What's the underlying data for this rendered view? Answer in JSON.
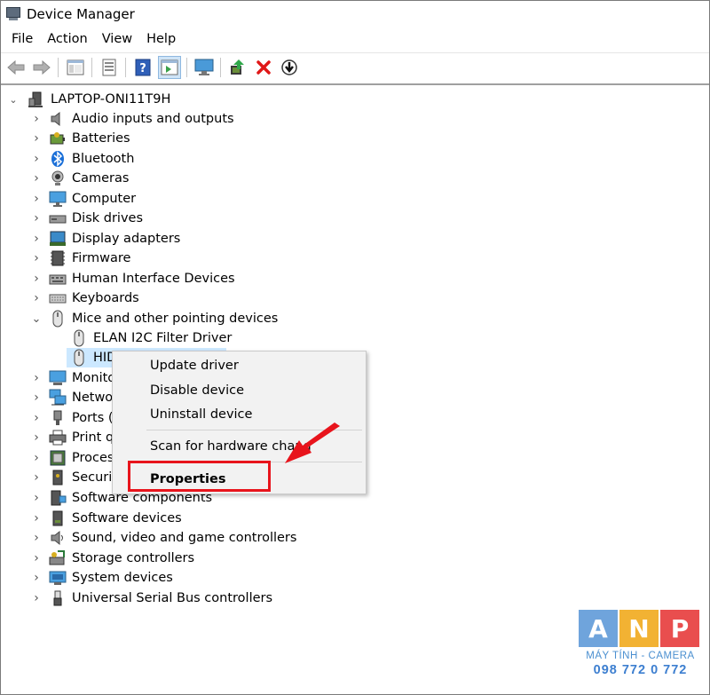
{
  "window": {
    "title": "Device Manager"
  },
  "menu": [
    "File",
    "Action",
    "View",
    "Help"
  ],
  "toolbar": [
    "back-icon",
    "forward-icon",
    "show-hide-console-tree-icon",
    "properties-icon",
    "help-icon",
    "action-pane-icon",
    "monitor-icon",
    "update-driver-icon",
    "uninstall-icon",
    "disable-icon"
  ],
  "tree": {
    "root": "LAPTOP-ONI11T9H",
    "categories": [
      {
        "label": "Audio inputs and outputs",
        "icon": "speaker-icon"
      },
      {
        "label": "Batteries",
        "icon": "battery-icon"
      },
      {
        "label": "Bluetooth",
        "icon": "bluetooth-icon"
      },
      {
        "label": "Cameras",
        "icon": "camera-icon"
      },
      {
        "label": "Computer",
        "icon": "computer-icon"
      },
      {
        "label": "Disk drives",
        "icon": "disk-icon"
      },
      {
        "label": "Display adapters",
        "icon": "display-adapter-icon"
      },
      {
        "label": "Firmware",
        "icon": "firmware-icon"
      },
      {
        "label": "Human Interface Devices",
        "icon": "hid-icon"
      },
      {
        "label": "Keyboards",
        "icon": "keyboard-icon"
      },
      {
        "label": "Mice and other pointing devices",
        "icon": "mouse-icon",
        "expanded": true
      },
      {
        "label": "Monito",
        "icon": "monitor-icon"
      },
      {
        "label": "Netwo",
        "icon": "network-icon"
      },
      {
        "label": "Ports (C",
        "icon": "port-icon"
      },
      {
        "label": "Print q",
        "icon": "printer-icon"
      },
      {
        "label": "Process",
        "icon": "processor-icon"
      },
      {
        "label": "Securit",
        "icon": "security-icon"
      },
      {
        "label": "Software components",
        "icon": "software-component-icon"
      },
      {
        "label": "Software devices",
        "icon": "software-device-icon"
      },
      {
        "label": "Sound, video and game controllers",
        "icon": "sound-icon"
      },
      {
        "label": "Storage controllers",
        "icon": "storage-icon"
      },
      {
        "label": "System devices",
        "icon": "system-icon"
      },
      {
        "label": "Universal Serial Bus controllers",
        "icon": "usb-icon"
      }
    ],
    "mice_children": [
      {
        "label": "ELAN I2C Filter Driver",
        "selected": false
      },
      {
        "label": "HID",
        "selected": true
      }
    ]
  },
  "context_menu": {
    "items": [
      "Update driver",
      "Disable device",
      "Uninstall device",
      "Scan for hardware chang",
      "Properties"
    ],
    "highlighted": "Properties",
    "highlight_color": "#e8141c"
  },
  "watermark": {
    "letters": [
      "A",
      "N",
      "P"
    ],
    "colors": [
      "#6fa4dc",
      "#f2b233",
      "#e94e4e"
    ],
    "subtitle": "MÁY TÍNH - CAMERA",
    "phone": "098 772 0 772"
  }
}
